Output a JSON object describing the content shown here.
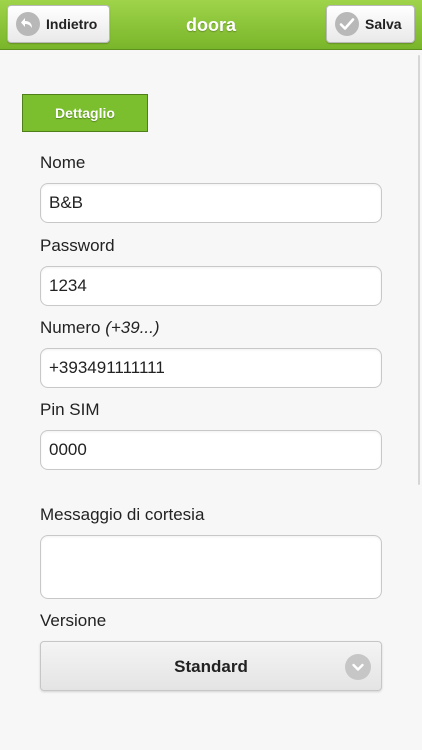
{
  "header": {
    "title": "doora",
    "back_label": "Indietro",
    "save_label": "Salva",
    "accent_color": "#7bbf2e"
  },
  "tabs": [
    {
      "label": "Dettaglio",
      "active": true
    }
  ],
  "form": {
    "name": {
      "label": "Nome",
      "value": "B&B"
    },
    "password": {
      "label": "Password",
      "value": "1234"
    },
    "number": {
      "label": "Numero",
      "hint": "(+39...)",
      "value": "+393491111111"
    },
    "pin": {
      "label": "Pin SIM",
      "value": "0000"
    },
    "courtesy_message": {
      "label": "Messaggio di cortesia",
      "value": ""
    },
    "version": {
      "label": "Versione",
      "value": "Standard"
    }
  },
  "icons": {
    "back": "back-arrow-icon",
    "save": "checkmark-icon",
    "select": "chevron-down-icon"
  }
}
